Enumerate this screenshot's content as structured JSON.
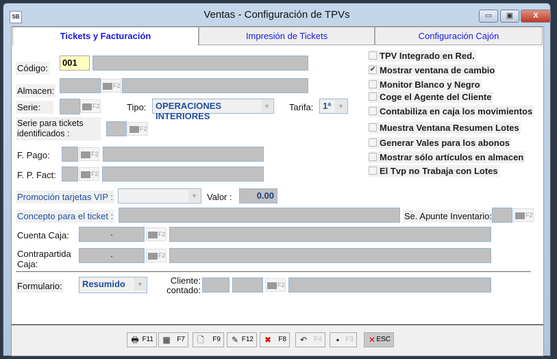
{
  "window": {
    "title": "Ventas - Configuración de TPVs",
    "logo": "SB",
    "min": "▭",
    "max": "▣",
    "close": "X"
  },
  "tabs": [
    {
      "label": "Tickets y Facturación"
    },
    {
      "label": "Impresión de Tickets"
    },
    {
      "label": "Configuración Cajón"
    }
  ],
  "form": {
    "codigo_label": "Código:",
    "codigo_value": "001",
    "almacen_label": "Almacen:",
    "serie_label": "Serie:",
    "tipo_label": "Tipo:",
    "tipo_value": "OPERACIONES INTERIORES",
    "tarifa_label": "Tarifa:",
    "tarifa_value": "1ª",
    "serie_tickets_label": "Serie para tickets identificados :",
    "fpago_label": "F. Pago:",
    "fpfact_label": "F. P. Fact:",
    "promo_label": "Promoción tarjetas VIP :",
    "valor_label": "Valor :",
    "valor_value": "0.00",
    "concepto_label": "Concepto para el ticket :",
    "apunte_label": "Se. Apunte Inventario:",
    "cuenta_label": "Cuenta Caja:",
    "cuenta_value": ".",
    "contrapartida_label": "Contrapartida Caja:",
    "contrapartida_value": ".",
    "formulario_label": "Formulario:",
    "formulario_value": "Resumido",
    "cliente_label": "Cliente: contado:",
    "f2": "F2"
  },
  "checks": [
    {
      "label": "TPV Integrado en Red.",
      "checked": false
    },
    {
      "label": "Mostrar ventana de cambio",
      "checked": true
    },
    {
      "label": "Monitor Blanco y Negro",
      "checked": false
    },
    {
      "label": "Coge el Agente del Cliente",
      "checked": false
    },
    {
      "label": "Contabiliza en caja los movimientos",
      "checked": false
    },
    {
      "label": "Muestra Ventana Resumen Lotes",
      "checked": false
    },
    {
      "label": "Generar Vales para los abonos",
      "checked": false
    },
    {
      "label": "Mostrar sólo artículos en almacen",
      "checked": false
    },
    {
      "label": "El Tvp no Trabaja con Lotes",
      "checked": false
    }
  ],
  "toolbar": [
    {
      "key": "F11",
      "icon": "printer-icon",
      "glyph": "🖶",
      "enabled": true
    },
    {
      "key": "F7",
      "icon": "search-binoculars-icon",
      "glyph": "▦",
      "enabled": true
    },
    {
      "key": "F9",
      "icon": "new-document-icon",
      "glyph": "🗋",
      "enabled": true
    },
    {
      "key": "F12",
      "icon": "edit-icon",
      "glyph": "✎",
      "enabled": true
    },
    {
      "key": "F8",
      "icon": "delete-icon",
      "glyph": "✖",
      "enabled": true
    },
    {
      "key": "F4",
      "icon": "undo-icon",
      "glyph": "↶",
      "enabled": false
    },
    {
      "key": "F3",
      "icon": "save-icon",
      "glyph": "▪",
      "enabled": false
    },
    {
      "key": "ESC",
      "icon": "exit-icon",
      "glyph": "✕",
      "enabled": true
    }
  ]
}
